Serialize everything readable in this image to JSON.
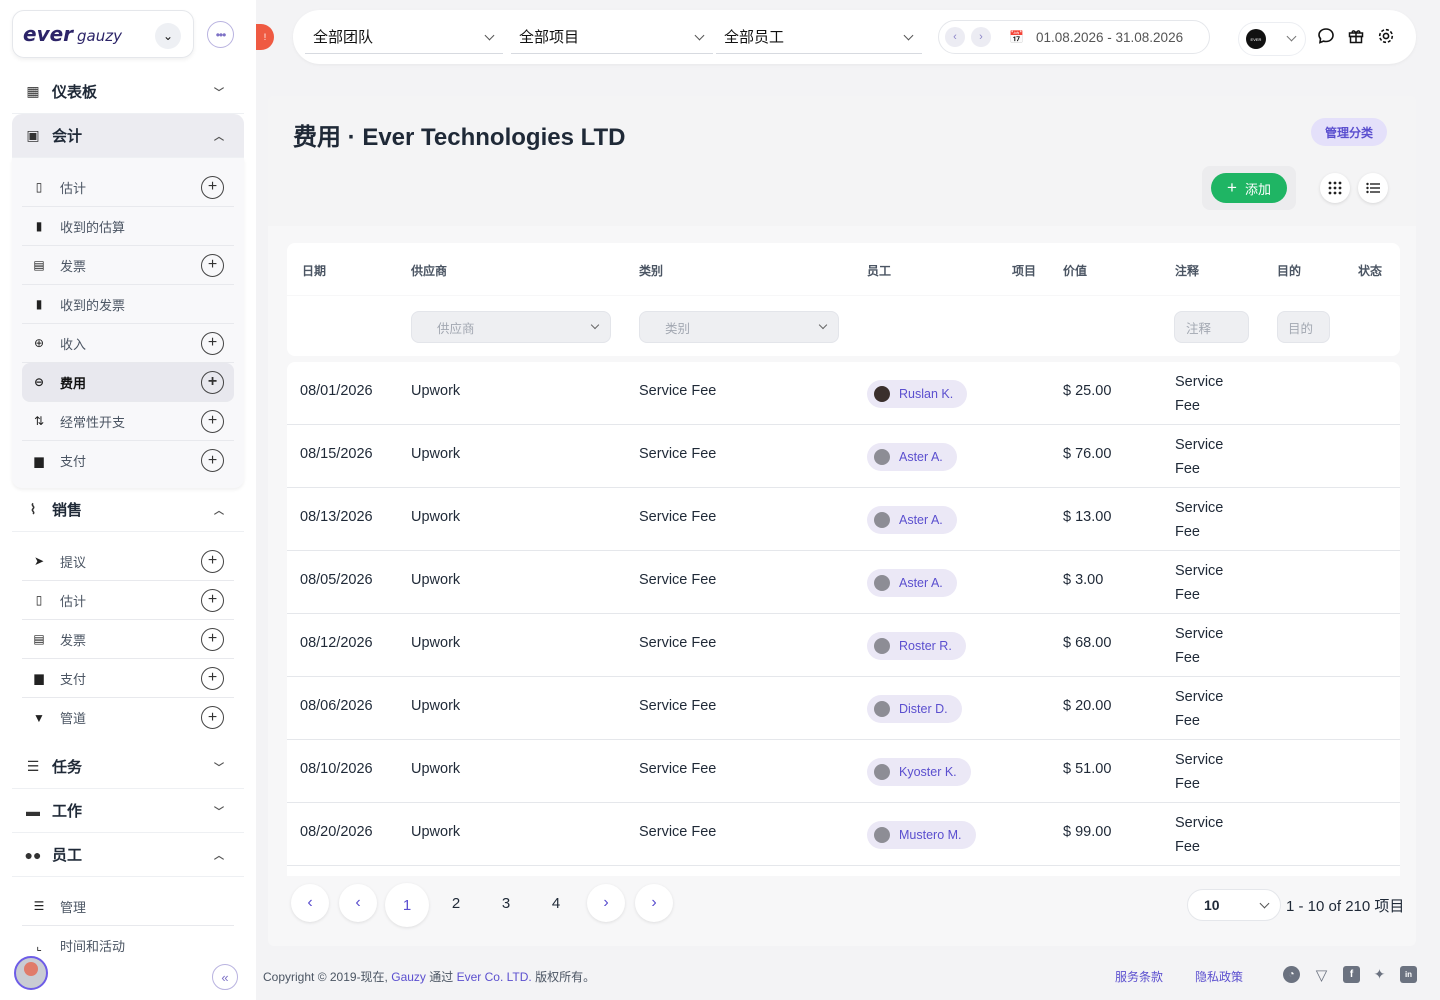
{
  "brand": {
    "name": "ever",
    "suffix": "gauzy"
  },
  "sidebar": {
    "groups": [
      {
        "label": "仪表板",
        "icon": "grid-icon",
        "expanded": false
      },
      {
        "label": "会计",
        "icon": "id-card-icon",
        "expanded": true,
        "items": [
          {
            "label": "估计",
            "icon": "file-icon",
            "add": true
          },
          {
            "label": "收到的估算",
            "icon": "file-text-icon",
            "add": false
          },
          {
            "label": "发票",
            "icon": "file-lines-icon",
            "add": true
          },
          {
            "label": "收到的发票",
            "icon": "file-invoice-icon",
            "add": false
          },
          {
            "label": "收入",
            "icon": "plus-circle-icon",
            "add": true
          },
          {
            "label": "费用",
            "icon": "minus-circle-icon",
            "add": true,
            "active": true
          },
          {
            "label": "经常性开支",
            "icon": "sort-icon",
            "add": true
          },
          {
            "label": "支付",
            "icon": "cash-register-icon",
            "add": true
          }
        ]
      },
      {
        "label": "销售",
        "icon": "chart-line-icon",
        "expanded": true,
        "items": [
          {
            "label": "提议",
            "icon": "paper-plane-icon",
            "add": true
          },
          {
            "label": "估计",
            "icon": "file-icon",
            "add": true
          },
          {
            "label": "发票",
            "icon": "file-lines-icon",
            "add": true
          },
          {
            "label": "支付",
            "icon": "cash-register-icon",
            "add": true
          },
          {
            "label": "管道",
            "icon": "filter-icon",
            "add": true
          }
        ]
      },
      {
        "label": "任务",
        "icon": "tasks-icon",
        "expanded": false
      },
      {
        "label": "工作",
        "icon": "briefcase-icon",
        "expanded": false
      },
      {
        "label": "员工",
        "icon": "users-icon",
        "expanded": true,
        "items": [
          {
            "label": "管理",
            "icon": "list-icon",
            "add": false
          },
          {
            "label": "时间和活动",
            "icon": "chart-icon",
            "add": false
          }
        ]
      }
    ]
  },
  "topbar": {
    "team_select": "全部团队",
    "project_select": "全部项目",
    "employee_select": "全部员工",
    "date_range": "01.08.2026 - 31.08.2026",
    "org_logo_text": "EVER"
  },
  "page": {
    "title_bold": "费用",
    "title_rest": " · Ever Technologies LTD",
    "manage_label": "管理分类",
    "add_label": "添加"
  },
  "table": {
    "columns": [
      "日期",
      "供应商",
      "类别",
      "员工",
      "项目",
      "价值",
      "注释",
      "目的",
      "状态"
    ],
    "filters": {
      "vendor_placeholder": "供应商",
      "category_placeholder": "类别",
      "notes_placeholder": "注释",
      "purpose_placeholder": "目的"
    },
    "rows": [
      {
        "date": "08/01/2026",
        "vendor": "Upwork",
        "category": "Service Fee",
        "employee": "Ruslan K.",
        "value": "$ 25.00",
        "note1": "Service",
        "note2": "Fee",
        "photo": true
      },
      {
        "date": "08/15/2026",
        "vendor": "Upwork",
        "category": "Service Fee",
        "employee": "Aster A.",
        "value": "$ 76.00",
        "note1": "Service",
        "note2": "Fee",
        "photo": false
      },
      {
        "date": "08/13/2026",
        "vendor": "Upwork",
        "category": "Service Fee",
        "employee": "Aster A.",
        "value": "$ 13.00",
        "note1": "Service",
        "note2": "Fee",
        "photo": false
      },
      {
        "date": "08/05/2026",
        "vendor": "Upwork",
        "category": "Service Fee",
        "employee": "Aster A.",
        "value": "$ 3.00",
        "note1": "Service",
        "note2": "Fee",
        "photo": false
      },
      {
        "date": "08/12/2026",
        "vendor": "Upwork",
        "category": "Service Fee",
        "employee": "Roster R.",
        "value": "$ 68.00",
        "note1": "Service",
        "note2": "Fee",
        "photo": false
      },
      {
        "date": "08/06/2026",
        "vendor": "Upwork",
        "category": "Service Fee",
        "employee": "Dister D.",
        "value": "$ 20.00",
        "note1": "Service",
        "note2": "Fee",
        "photo": false
      },
      {
        "date": "08/10/2026",
        "vendor": "Upwork",
        "category": "Service Fee",
        "employee": "Kyoster K.",
        "value": "$ 51.00",
        "note1": "Service",
        "note2": "Fee",
        "photo": false
      },
      {
        "date": "08/20/2026",
        "vendor": "Upwork",
        "category": "Service Fee",
        "employee": "Mustero M.",
        "value": "$ 99.00",
        "note1": "Service",
        "note2": "Fee",
        "photo": false
      }
    ]
  },
  "pagination": {
    "pages": [
      "1",
      "2",
      "3",
      "4"
    ],
    "current": "1",
    "per_page": "10",
    "range_text": "1 - 10 of 210 项目"
  },
  "footer": {
    "copy_prefix": "Copyright © 2019-现在, ",
    "gauzy": "Gauzy",
    "via": " 通过 ",
    "company": "Ever Co. LTD.",
    "rights": " 版权所有。",
    "terms": "服务条款",
    "privacy": "隐私政策"
  },
  "colors": {
    "accent": "#5b4fcf",
    "add_green": "#1fb564",
    "alert_red": "#ef5a42"
  }
}
